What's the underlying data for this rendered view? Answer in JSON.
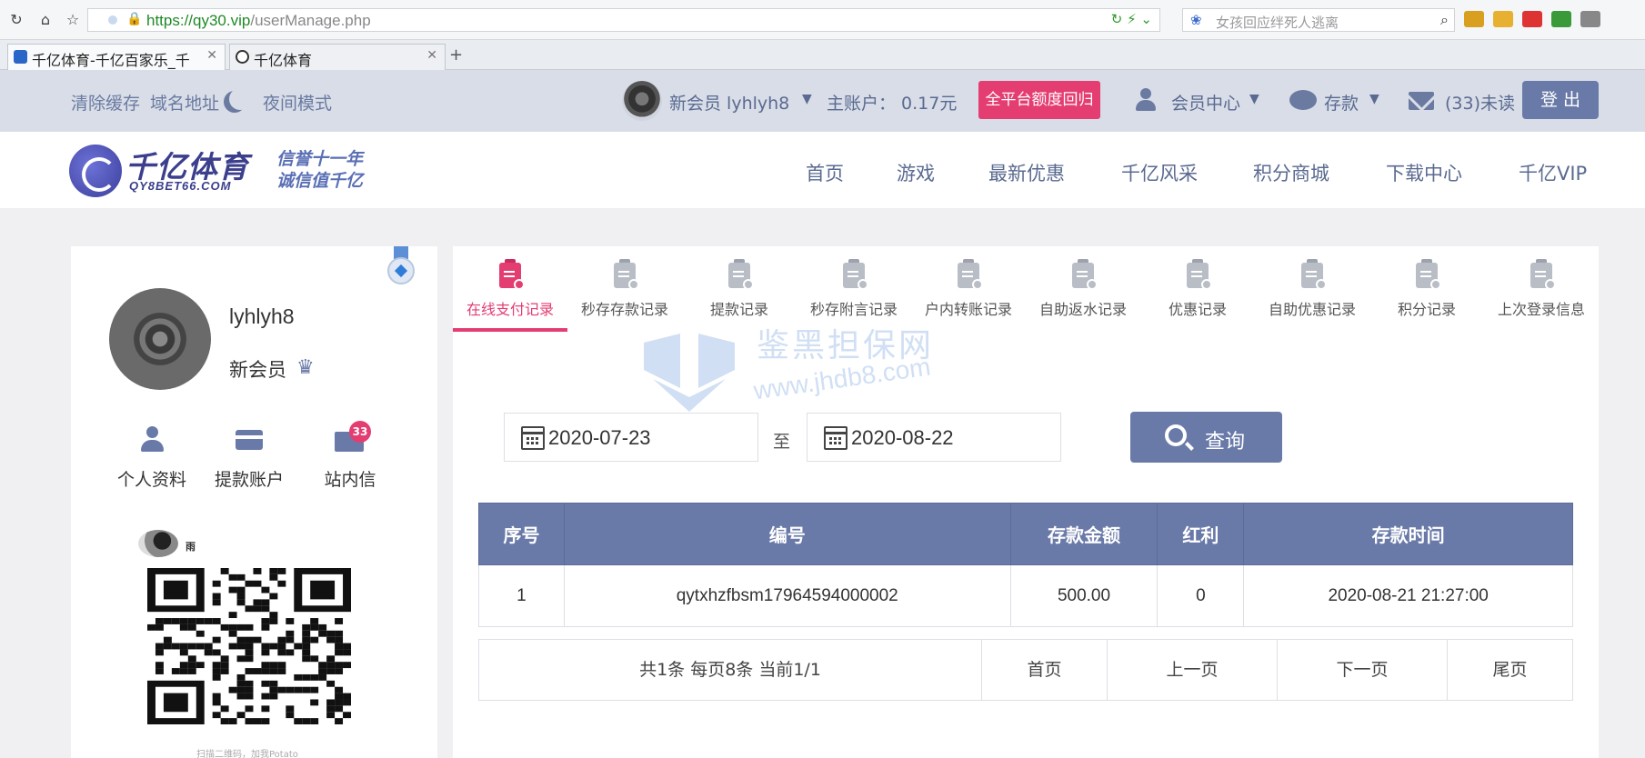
{
  "browser": {
    "url_host": "https://qy30.vip",
    "url_path": "/userManage.php",
    "search_placeholder": "女孩回应绊死人逃离",
    "tabs": [
      {
        "label": "千亿体育-千亿百家乐_千"
      },
      {
        "label": "千亿体育"
      }
    ]
  },
  "topbar": {
    "clear_cache": "清除缓存",
    "domain": "域名地址",
    "night_mode": "夜间模式",
    "member": "新会员 lyhlyh8",
    "main_account": "主账户： 0.17元",
    "recall_button": "全平台额度回归",
    "member_center": "会员中心",
    "deposit": "存款",
    "unread": "(33)未读",
    "logout": "登 出"
  },
  "logo": {
    "name": "千亿体育",
    "domain": "QY8BET66.COM",
    "slogan_line1": "信誉十一年",
    "slogan_line2": "诚信值千亿"
  },
  "nav": [
    "首页",
    "游戏",
    "最新优惠",
    "千亿风采",
    "积分商城",
    "下载中心",
    "千亿VIP"
  ],
  "sidebar": {
    "username": "lyhlyh8",
    "level": "新会员",
    "actions": [
      "个人资料",
      "提款账户",
      "站内信"
    ],
    "message_count": "33",
    "qr_owner": "雨",
    "qr_caption": "扫描二维码，加我Potato"
  },
  "record_tabs": [
    "在线支付记录",
    "秒存存款记录",
    "提款记录",
    "秒存附言记录",
    "户内转账记录",
    "自助返水记录",
    "优惠记录",
    "自助优惠记录",
    "积分记录",
    "上次登录信息"
  ],
  "active_tab_index": 0,
  "watermark": {
    "text": "鉴黑担保网",
    "url": "www.jhdb8.com"
  },
  "filter": {
    "date_from": "2020-07-23",
    "to_label": "至",
    "date_to": "2020-08-22",
    "query_button": "查询"
  },
  "table": {
    "headers": [
      "序号",
      "编号",
      "存款金额",
      "红利",
      "存款时间"
    ],
    "rows": [
      [
        "1",
        "qytxhzfbsm17964594000002",
        "500.00",
        "0",
        "2020-08-21 21:27:00"
      ]
    ]
  },
  "pager": {
    "summary": "共1条 每页8条 当前1/1",
    "first": "首页",
    "prev": "上一页",
    "next": "下一页",
    "last": "尾页"
  },
  "colors": {
    "accent": "#6a7aa8",
    "pink": "#e43d71",
    "topbar_bg": "#d8dde8"
  }
}
